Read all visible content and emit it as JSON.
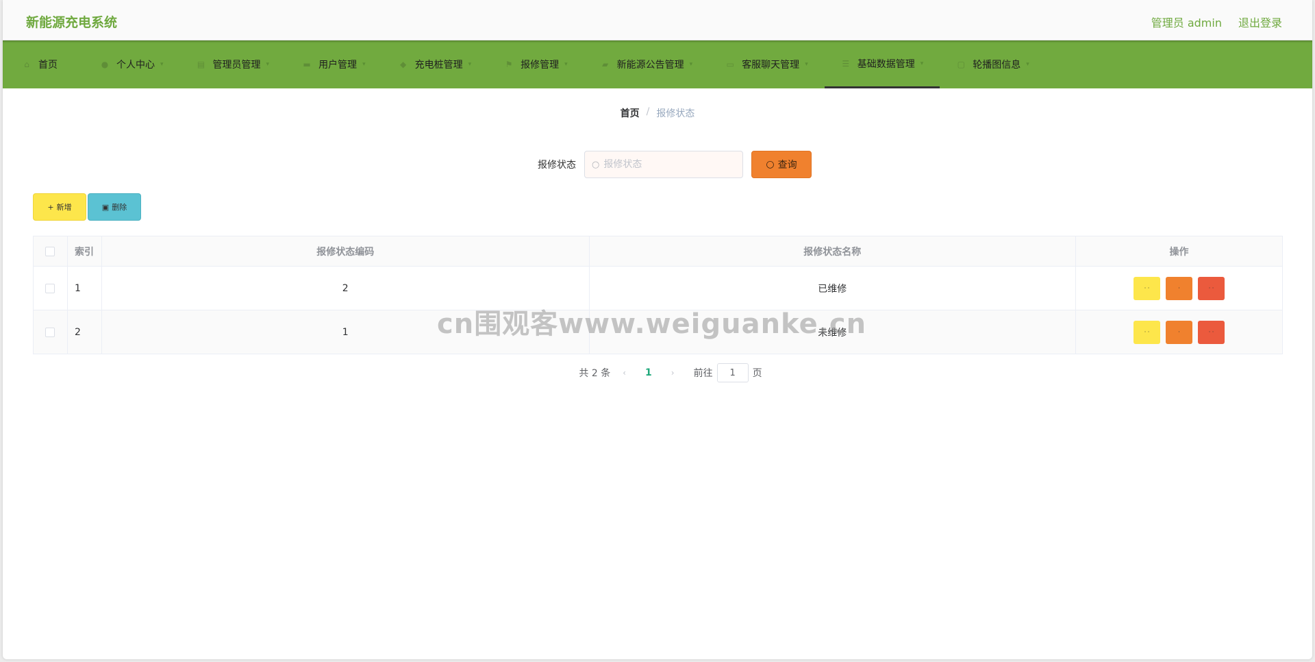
{
  "header": {
    "title": "新能源充电系统",
    "user_label": "管理员 admin",
    "logout_label": "退出登录"
  },
  "nav": {
    "items": [
      {
        "label": "首页",
        "icon": "home-icon"
      },
      {
        "label": "个人中心",
        "icon": "user-icon"
      },
      {
        "label": "管理员管理",
        "icon": "doc-icon"
      },
      {
        "label": "用户管理",
        "icon": "folder-icon"
      },
      {
        "label": "充电桩管理",
        "icon": "car-icon"
      },
      {
        "label": "报修管理",
        "icon": "flag-icon"
      },
      {
        "label": "新能源公告管理",
        "icon": "chat-icon"
      },
      {
        "label": "客服聊天管理",
        "icon": "message-icon"
      },
      {
        "label": "基础数据管理",
        "icon": "list-icon"
      },
      {
        "label": "轮播图信息",
        "icon": "image-icon"
      }
    ],
    "active_index": 8
  },
  "breadcrumb": {
    "home": "首页",
    "separator": "/",
    "current": "报修状态"
  },
  "search": {
    "label": "报修状态",
    "placeholder": "报修状态",
    "value": "",
    "query_label": "查询"
  },
  "actions": {
    "add_label": "新增",
    "delete_label": "删除"
  },
  "table": {
    "columns": [
      "索引",
      "报修状态编码",
      "报修状态名称",
      "操作"
    ],
    "rows": [
      {
        "index": "1",
        "code": "2",
        "name": "已维修"
      },
      {
        "index": "2",
        "code": "1",
        "name": "未维修"
      }
    ]
  },
  "pagination": {
    "total": "共 2 条",
    "current_page": "1",
    "goto_prefix": "前往",
    "goto_value": "1",
    "goto_suffix": "页"
  },
  "watermark": "cn围观客www.weiguanke.cn",
  "colors": {
    "brand": "#6fa93f",
    "nav_bg": "#71aa3f",
    "query": "#f0812e",
    "add": "#fde64b",
    "delete": "#5bc2d3",
    "op_delete": "#eb5a3d",
    "page_active": "#21a97c"
  }
}
